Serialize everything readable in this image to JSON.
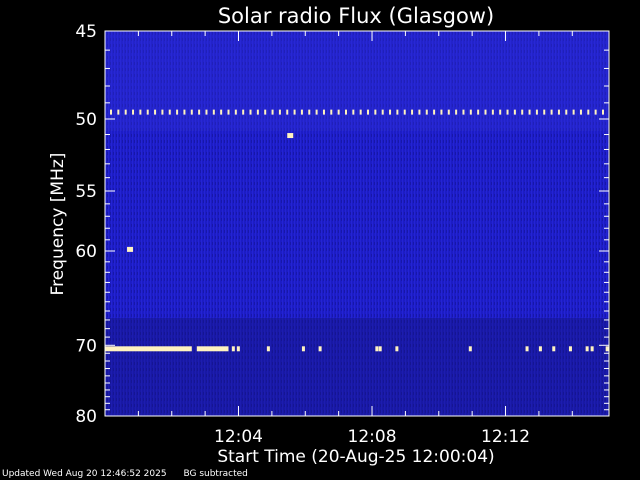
{
  "chart_data": {
    "type": "heatmap",
    "title": "Solar radio Flux (Glasgow)",
    "xlabel": "Start Time (20-Aug-25 12:00:04)",
    "ylabel": "Frequency [MHz]",
    "x_range_minutes": [
      0.0,
      15.1
    ],
    "x_tick_labels": [
      {
        "label": "12:04",
        "minutes": 4.0
      },
      {
        "label": "12:08",
        "minutes": 8.0
      },
      {
        "label": "12:12",
        "minutes": 12.0
      }
    ],
    "y_range_mhz": [
      45,
      80
    ],
    "y_scale": "reciprocal",
    "y_tick_labels": [
      {
        "label": "45",
        "mhz": 45
      },
      {
        "label": "50",
        "mhz": 50
      },
      {
        "label": "55",
        "mhz": 55
      },
      {
        "label": "60",
        "mhz": 60
      },
      {
        "label": "70",
        "mhz": 70
      },
      {
        "label": "80",
        "mhz": 80
      }
    ],
    "background_color": "#2020c8",
    "interference_bands": [
      {
        "mhz": 49.6,
        "style": "dashed",
        "color": "#fff3c0"
      },
      {
        "mhz": 70.5,
        "style": "intermittent",
        "color": "#fff3c0"
      }
    ],
    "bright_spots": [
      {
        "minutes": 0.75,
        "mhz": 59.9
      },
      {
        "minutes": 5.55,
        "mhz": 51.1
      }
    ],
    "grid": false
  },
  "footer": {
    "updated": "Updated Wed Aug 20 12:46:52 2025",
    "bg_note": "BG subtracted"
  }
}
